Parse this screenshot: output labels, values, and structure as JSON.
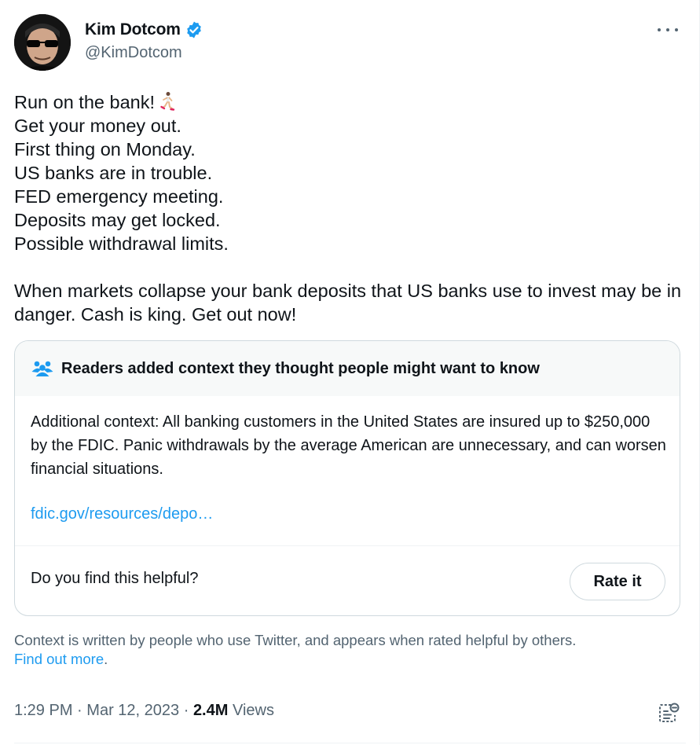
{
  "author": {
    "display_name": "Kim Dotcom",
    "handle": "@KimDotcom",
    "verified": true,
    "avatar_icon": "profile-photo"
  },
  "more_icon": "ellipsis-icon",
  "tweet": {
    "lines": [
      "Run on the bank!",
      "Get your money out.",
      "First thing on Monday.",
      "US banks are in trouble.",
      "FED emergency meeting.",
      "Deposits may get locked.",
      "Possible withdrawal limits."
    ],
    "emoji": "person-running-emoji",
    "paragraph": "When markets collapse your bank deposits that US banks use to invest may be in danger. Cash is king. Get out now!"
  },
  "community_note": {
    "title": "Readers added context they thought people might want to know",
    "icon": "people-icon",
    "body": "Additional context: All banking customers in the United States are insured up to $250,000 by the FDIC. Panic withdrawals by the average American are unnecessary, and can worsen financial situations.",
    "link": "fdic.gov/resources/depo…",
    "helpful_prompt": "Do you find this helpful?",
    "rate_label": "Rate it"
  },
  "disclaimer": {
    "text": "Context is written by people who use Twitter, and appears when rated helpful by others.",
    "link": "Find out more",
    "suffix": "."
  },
  "meta": {
    "time": "1:29 PM",
    "separator": "·",
    "date": "Mar 12, 2023",
    "views_count": "2.4M",
    "views_label": "Views"
  },
  "colors": {
    "accent": "#1d9bf0",
    "text_primary": "#0f1419",
    "text_secondary": "#536471",
    "border": "#cfd9de"
  }
}
